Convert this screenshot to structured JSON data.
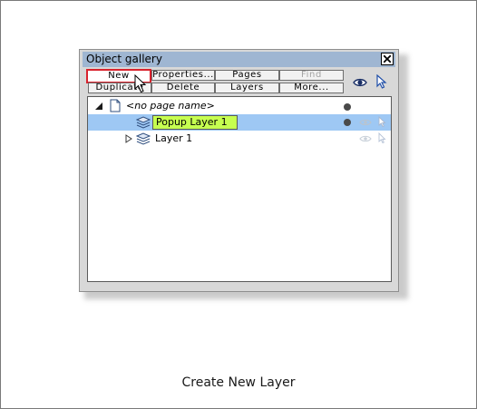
{
  "gallery": {
    "title": "Object gallery"
  },
  "toolbar": {
    "row1": [
      "New",
      "Properties...",
      "Pages",
      "Find"
    ],
    "row2": [
      "Duplicate",
      "Delete",
      "Layers",
      "More..."
    ],
    "find_disabled": true
  },
  "tree": {
    "page_label": "<no page name>",
    "layers": [
      {
        "name": "Popup Layer 1",
        "selected": true,
        "editing": true
      },
      {
        "name": "Layer 1",
        "selected": false,
        "editing": false
      }
    ]
  },
  "caption": "Create New Layer",
  "colors": {
    "titlebar": "#9fb6d2",
    "selection": "#9ec8f4",
    "edit_highlight": "#c6ff50",
    "button_highlight": "#d9232e"
  }
}
